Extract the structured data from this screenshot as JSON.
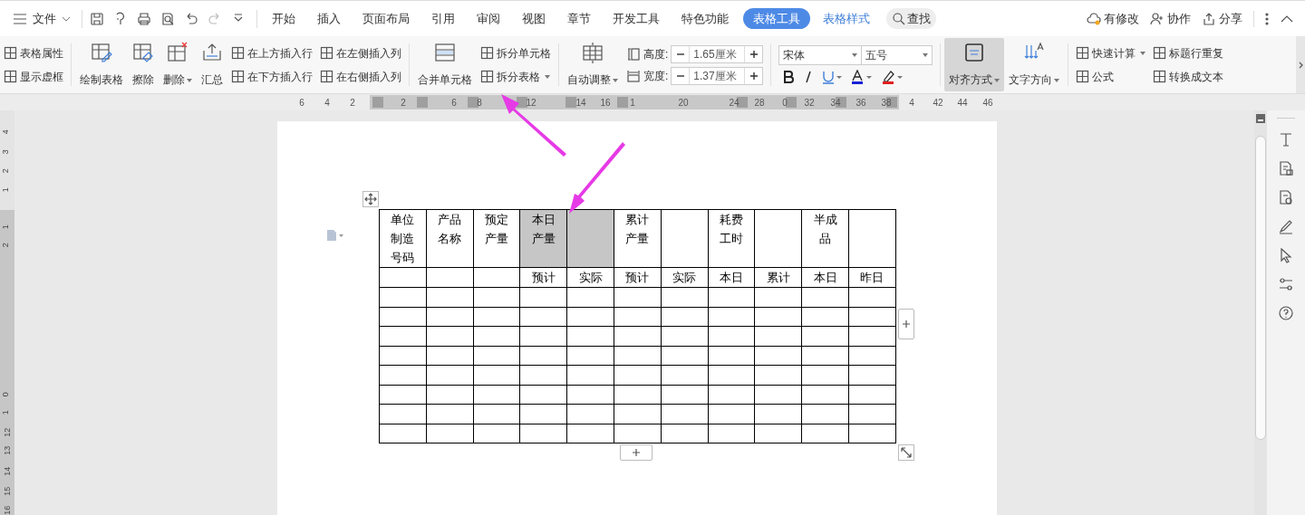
{
  "menu": {
    "file": "文件"
  },
  "tabs": [
    {
      "label": "开始",
      "selected": false,
      "contextual": false
    },
    {
      "label": "插入",
      "selected": false,
      "contextual": false
    },
    {
      "label": "页面布局",
      "selected": false,
      "contextual": false
    },
    {
      "label": "引用",
      "selected": false,
      "contextual": false
    },
    {
      "label": "审阅",
      "selected": false,
      "contextual": false
    },
    {
      "label": "视图",
      "selected": false,
      "contextual": false
    },
    {
      "label": "章节",
      "selected": false,
      "contextual": false
    },
    {
      "label": "开发工具",
      "selected": false,
      "contextual": false
    },
    {
      "label": "特色功能",
      "selected": false,
      "contextual": false
    },
    {
      "label": "表格工具",
      "selected": true,
      "contextual": true
    },
    {
      "label": "表格样式",
      "selected": false,
      "contextual": true
    }
  ],
  "search": {
    "label": "查找"
  },
  "actions": [
    "有修改",
    "协作",
    "分享"
  ],
  "ribbon": [
    {
      "kind": "stack",
      "items": [
        {
          "label": "表格属性",
          "dropdown": false
        },
        {
          "label": "显示虚框",
          "dropdown": false
        }
      ]
    },
    {
      "kind": "big",
      "label": "绘制表格",
      "dropdown": false,
      "pressed": false
    },
    {
      "kind": "big",
      "label": "擦除",
      "dropdown": false,
      "pressed": false
    },
    {
      "kind": "big",
      "label": "删除",
      "dropdown": true,
      "pressed": false
    },
    {
      "kind": "big",
      "label": "汇总",
      "dropdown": false,
      "pressed": false
    },
    {
      "kind": "stack",
      "items": [
        {
          "label": "在上方插入行",
          "dropdown": false
        },
        {
          "label": "在下方插入行",
          "dropdown": false
        }
      ]
    },
    {
      "kind": "stack",
      "items": [
        {
          "label": "在左侧插入列",
          "dropdown": false
        },
        {
          "label": "在右侧插入列",
          "dropdown": false
        }
      ]
    },
    {
      "kind": "big",
      "label": "合并单元格",
      "dropdown": false,
      "pressed": false
    },
    {
      "kind": "stack",
      "items": [
        {
          "label": "拆分单元格",
          "dropdown": false
        },
        {
          "label": "拆分表格",
          "dropdown": true
        }
      ]
    },
    {
      "kind": "big",
      "label": "自动调整",
      "dropdown": true,
      "pressed": false
    },
    {
      "kind": "size",
      "fields": [
        {
          "label": "高度:",
          "value": "1.65厘米"
        },
        {
          "label": "宽度:",
          "value": "1.37厘米"
        }
      ]
    },
    {
      "kind": "font",
      "family": "宋体",
      "size": "五号"
    },
    {
      "kind": "big",
      "label": "对齐方式",
      "dropdown": true,
      "pressed": true
    },
    {
      "kind": "big",
      "label": "文字方向",
      "dropdown": true,
      "pressed": false
    },
    {
      "kind": "stack",
      "items": [
        {
          "label": "快速计算",
          "dropdown": true
        },
        {
          "label": "公式",
          "dropdown": false
        }
      ]
    },
    {
      "kind": "stack",
      "items": [
        {
          "label": "标题行重复",
          "dropdown": false
        },
        {
          "label": "转换成文本",
          "dropdown": false
        }
      ]
    }
  ],
  "ruler": [
    "6",
    "4",
    "2",
    "2",
    "6",
    "8",
    "12",
    "14",
    "16",
    "1",
    "20",
    "24",
    "28",
    "0",
    "32",
    "34",
    "36",
    "38",
    "4",
    "42",
    "44",
    "46"
  ],
  "vertical_ruler": [
    "4",
    "3",
    "2",
    "1",
    "1",
    "2",
    "0",
    "1",
    "12",
    "13",
    "14",
    "15",
    "16"
  ],
  "table": {
    "rows": [
      {
        "cells": [
          {
            "text": "单位制造号码",
            "selected": false
          },
          {
            "text": "产品名称",
            "selected": false
          },
          {
            "text": "预定产量",
            "selected": false
          },
          {
            "text": "本日产量",
            "selected": true
          },
          {
            "selected": true
          },
          {
            "text": "累计产量",
            "selected": false
          },
          {
            "selected": false
          },
          {
            "text": "耗费工时",
            "selected": false
          },
          {
            "selected": false
          },
          {
            "text": "半成品",
            "selected": false
          },
          {
            "selected": false
          }
        ]
      },
      {
        "cells": [
          {
            "selected": false
          },
          {
            "selected": false
          },
          {
            "selected": false
          },
          {
            "text": "预计",
            "selected": false
          },
          {
            "text": "实际",
            "selected": false
          },
          {
            "text": "预计",
            "selected": false
          },
          {
            "text": "实际",
            "selected": false
          },
          {
            "text": "本日",
            "selected": false
          },
          {
            "text": "累计",
            "selected": false
          },
          {
            "text": "本日",
            "selected": false
          },
          {
            "text": "昨日",
            "selected": false
          }
        ]
      },
      {
        "cells": [
          {
            "selected": false
          },
          {
            "selected": false
          },
          {
            "selected": false
          },
          {
            "selected": false
          },
          {
            "selected": false
          },
          {
            "selected": false
          },
          {
            "selected": false
          },
          {
            "selected": false
          },
          {
            "selected": false
          },
          {
            "selected": false
          },
          {
            "selected": false
          }
        ]
      },
      {
        "cells": [
          {
            "selected": false
          },
          {
            "selected": false
          },
          {
            "selected": false
          },
          {
            "selected": false
          },
          {
            "selected": false
          },
          {
            "selected": false
          },
          {
            "selected": false
          },
          {
            "selected": false
          },
          {
            "selected": false
          },
          {
            "selected": false
          },
          {
            "selected": false
          }
        ]
      },
      {
        "cells": [
          {
            "selected": false
          },
          {
            "selected": false
          },
          {
            "selected": false
          },
          {
            "selected": false
          },
          {
            "selected": false
          },
          {
            "selected": false
          },
          {
            "selected": false
          },
          {
            "selected": false
          },
          {
            "selected": false
          },
          {
            "selected": false
          },
          {
            "selected": false
          }
        ]
      },
      {
        "cells": [
          {
            "selected": false
          },
          {
            "selected": false
          },
          {
            "selected": false
          },
          {
            "selected": false
          },
          {
            "selected": false
          },
          {
            "selected": false
          },
          {
            "selected": false
          },
          {
            "selected": false
          },
          {
            "selected": false
          },
          {
            "selected": false
          },
          {
            "selected": false
          }
        ]
      },
      {
        "cells": [
          {
            "selected": false
          },
          {
            "selected": false
          },
          {
            "selected": false
          },
          {
            "selected": false
          },
          {
            "selected": false
          },
          {
            "selected": false
          },
          {
            "selected": false
          },
          {
            "selected": false
          },
          {
            "selected": false
          },
          {
            "selected": false
          },
          {
            "selected": false
          }
        ]
      },
      {
        "cells": [
          {
            "selected": false
          },
          {
            "selected": false
          },
          {
            "selected": false
          },
          {
            "selected": false
          },
          {
            "selected": false
          },
          {
            "selected": false
          },
          {
            "selected": false
          },
          {
            "selected": false
          },
          {
            "selected": false
          },
          {
            "selected": false
          },
          {
            "selected": false
          }
        ]
      },
      {
        "cells": [
          {
            "selected": false
          },
          {
            "selected": false
          },
          {
            "selected": false
          },
          {
            "selected": false
          },
          {
            "selected": false
          },
          {
            "selected": false
          },
          {
            "selected": false
          },
          {
            "selected": false
          },
          {
            "selected": false
          },
          {
            "selected": false
          },
          {
            "selected": false
          }
        ]
      },
      {
        "cells": [
          {
            "selected": false
          },
          {
            "selected": false
          },
          {
            "selected": false
          },
          {
            "selected": false
          },
          {
            "selected": false
          },
          {
            "selected": false
          },
          {
            "selected": false
          },
          {
            "selected": false
          },
          {
            "selected": false
          },
          {
            "selected": false
          },
          {
            "selected": false
          }
        ]
      }
    ]
  }
}
